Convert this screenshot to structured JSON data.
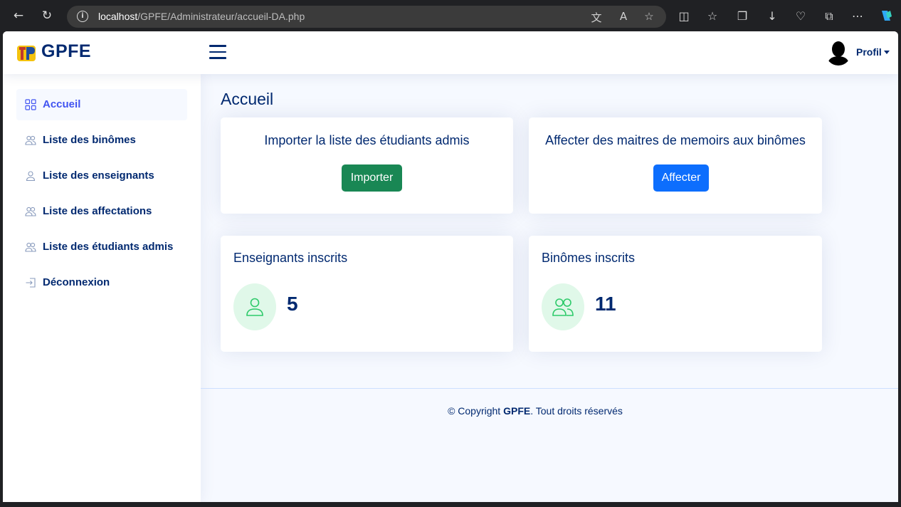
{
  "browser": {
    "url_host": "localhost",
    "url_path": "/GPFE/Administrateur/accueil-DA.php"
  },
  "header": {
    "brand": "GPFE",
    "profile_label": "Profil"
  },
  "sidebar": {
    "items": [
      {
        "label": "Accueil",
        "icon": "grid-icon",
        "active": true
      },
      {
        "label": "Liste des binômes",
        "icon": "people-icon",
        "active": false
      },
      {
        "label": "Liste des enseignants",
        "icon": "person-icon",
        "active": false
      },
      {
        "label": "Liste des affectations",
        "icon": "people-icon",
        "active": false
      },
      {
        "label": "Liste des étudiants admis",
        "icon": "people-icon",
        "active": false
      },
      {
        "label": "Déconnexion",
        "icon": "logout-icon",
        "active": false
      }
    ]
  },
  "main": {
    "title": "Accueil",
    "import_card": {
      "title": "Importer la liste des étudiants admis",
      "button": "Importer"
    },
    "assign_card": {
      "title": "Affecter des maitres de memoirs aux binômes",
      "button": "Affecter"
    },
    "teachers_card": {
      "title": "Enseignants inscrits",
      "value": "5"
    },
    "pairs_card": {
      "title": "Binômes inscrits",
      "value": "11"
    }
  },
  "footer": {
    "prefix": "© Copyright ",
    "brand": "GPFE",
    "suffix": ". Tout droits réservés"
  },
  "colors": {
    "primary": "#012970",
    "active": "#4154f1",
    "green_button": "#198754",
    "blue_button": "#0d6efd",
    "icon_bg": "#e0f8e9",
    "icon_fg": "#2eca6a"
  }
}
